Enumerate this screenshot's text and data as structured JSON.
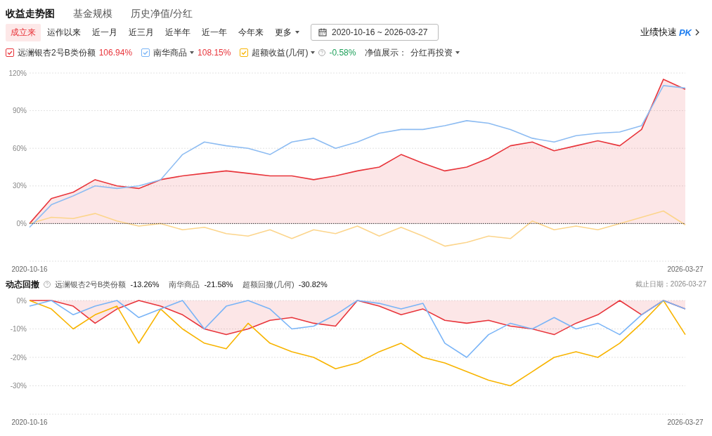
{
  "tabs": [
    {
      "label": "收益走势图",
      "selected": true
    },
    {
      "label": "基金规模",
      "selected": false
    },
    {
      "label": "历史净值/分红",
      "selected": false
    }
  ],
  "periods": [
    {
      "label": "成立来",
      "selected": true,
      "kind": "button"
    },
    {
      "label": "运作以来",
      "selected": false,
      "kind": "button"
    },
    {
      "label": "近一月",
      "selected": false,
      "kind": "button"
    },
    {
      "label": "近三月",
      "selected": false,
      "kind": "button"
    },
    {
      "label": "近半年",
      "selected": false,
      "kind": "button"
    },
    {
      "label": "近一年",
      "selected": false,
      "kind": "button"
    },
    {
      "label": "今年来",
      "selected": false,
      "kind": "button"
    },
    {
      "label": "更多",
      "selected": false,
      "kind": "dropdown"
    }
  ],
  "date_range": {
    "value": "2020-10-16 ~ 2026-03-27"
  },
  "pk_link": {
    "label": "业绩快速",
    "badge": "PK"
  },
  "legend": [
    {
      "name": "远澜银杏2号B类份额",
      "checked": true,
      "color": "#e8353b",
      "dropdown": false,
      "help": false,
      "value": "106.94%"
    },
    {
      "name": "南华商品",
      "checked": true,
      "color": "#79b4f7",
      "dropdown": true,
      "help": false,
      "value": "108.15%"
    },
    {
      "name": "超额收益(几何)",
      "checked": true,
      "color": "#f8b400",
      "dropdown": true,
      "help": true,
      "value": "-0.58%"
    }
  ],
  "nav_display": {
    "label": "净值展示：",
    "value": "分红再投资"
  },
  "return_chart": {
    "chart_data": {
      "type": "line",
      "categories": [
        "2020-10-16",
        null,
        null,
        null,
        null,
        null,
        null,
        null,
        null,
        null,
        null,
        null,
        null,
        null,
        null,
        null,
        null,
        null,
        null,
        null,
        null,
        null,
        null,
        null,
        null,
        null,
        null,
        null,
        null,
        null,
        "2026-03-27"
      ],
      "yticks": [
        {
          "value": 0,
          "label": "0%"
        },
        {
          "value": 30,
          "label": "30%"
        },
        {
          "value": 60,
          "label": "60%"
        },
        {
          "value": 90,
          "label": "90%"
        },
        {
          "value": 120,
          "label": "120%"
        }
      ],
      "ylim": [
        -30,
        120
      ],
      "grid": true,
      "ref_lines": [
        {
          "axis": "y",
          "value": 0
        }
      ],
      "series": [
        {
          "type": "area",
          "color": "#e8353b",
          "values": [
            0,
            20,
            25,
            35,
            30,
            28,
            35,
            38,
            40,
            42,
            40,
            38,
            38,
            35,
            38,
            42,
            45,
            55,
            48,
            42,
            45,
            52,
            62,
            65,
            58,
            62,
            66,
            62,
            75,
            115,
            107
          ]
        },
        {
          "type": "line",
          "color": "#8dbcf2",
          "values": [
            -3,
            15,
            22,
            30,
            28,
            30,
            35,
            55,
            65,
            62,
            60,
            55,
            65,
            68,
            60,
            65,
            72,
            75,
            75,
            78,
            82,
            80,
            75,
            68,
            65,
            70,
            72,
            73,
            78,
            110,
            108
          ]
        },
        {
          "type": "line",
          "color": "#fcd58c",
          "values": [
            0,
            5,
            4,
            8,
            2,
            -2,
            0,
            -5,
            -3,
            -8,
            -10,
            -5,
            -12,
            -5,
            -8,
            -2,
            -10,
            -3,
            -10,
            -18,
            -15,
            -10,
            -12,
            2,
            -5,
            -2,
            -5,
            0,
            5,
            10,
            -1
          ]
        }
      ]
    }
  },
  "drawdown": {
    "title": "动态回撤",
    "items": [
      {
        "name": "远澜银杏2号B类份额",
        "value": "-13.26%"
      },
      {
        "name": "南华商品",
        "value": "-21.58%"
      },
      {
        "name": "超额回撤(几何)",
        "value": "-30.82%"
      }
    ],
    "cutoff": "截止日期：2026-03-27",
    "chart_data": {
      "type": "line",
      "categories": [
        "2020-10-16",
        null,
        null,
        null,
        null,
        null,
        null,
        null,
        null,
        null,
        null,
        null,
        null,
        null,
        null,
        null,
        null,
        null,
        null,
        null,
        null,
        null,
        null,
        null,
        null,
        null,
        null,
        null,
        null,
        null,
        "2026-03-27"
      ],
      "yticks": [
        {
          "value": 0,
          "label": "0%"
        },
        {
          "value": -10,
          "label": "-10%"
        },
        {
          "value": -20,
          "label": "-20%"
        },
        {
          "value": -30,
          "label": "-30%"
        }
      ],
      "ylim": [
        -40,
        0
      ],
      "grid": true,
      "series": [
        {
          "type": "area",
          "color": "#e8353b",
          "values": [
            0,
            0,
            -2,
            -8,
            -3,
            0,
            -2,
            -5,
            -10,
            -12,
            -10,
            -7,
            -6,
            -8,
            -9,
            0,
            -2,
            -5,
            -3,
            -7,
            -8,
            -7,
            -9,
            -10,
            -12,
            -8,
            -5,
            0,
            -5,
            0,
            -3
          ]
        },
        {
          "type": "line",
          "color": "#79b4f7",
          "values": [
            -2,
            0,
            -5,
            -2,
            0,
            -6,
            -3,
            0,
            -10,
            -2,
            0,
            -3,
            -10,
            -9,
            -5,
            0,
            -1,
            -3,
            -1,
            -15,
            -20,
            -12,
            -8,
            -10,
            -6,
            -10,
            -8,
            -12,
            -5,
            0,
            -3
          ]
        },
        {
          "type": "line",
          "color": "#f8b400",
          "values": [
            0,
            -3,
            -10,
            -5,
            -2,
            -15,
            -3,
            -10,
            -15,
            -17,
            -8,
            -15,
            -18,
            -20,
            -24,
            -22,
            -18,
            -15,
            -20,
            -22,
            -25,
            -28,
            -30,
            -25,
            -20,
            -18,
            -20,
            -15,
            -8,
            0,
            -12
          ]
        }
      ]
    }
  }
}
